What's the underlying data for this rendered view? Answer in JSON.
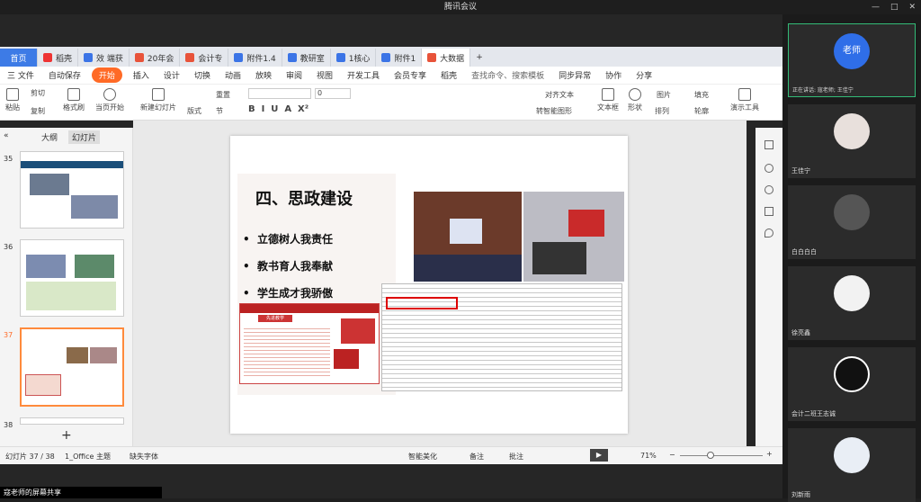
{
  "title": "腾讯会议",
  "tabs": [
    {
      "label": "首页"
    },
    {
      "label": "稻壳"
    },
    {
      "label": "效 端获"
    },
    {
      "label": "20年会"
    },
    {
      "label": "会计专"
    },
    {
      "label": "附件1.4"
    },
    {
      "label": "教研室"
    },
    {
      "label": "1核心"
    },
    {
      "label": "附件1"
    },
    {
      "label": "大数据"
    }
  ],
  "menus": [
    "三 文件",
    "自动保存",
    "开始",
    "插入",
    "设计",
    "切换",
    "动画",
    "放映",
    "审阅",
    "视图",
    "开发工具",
    "会员专享",
    "稻壳",
    "查找命令、搜索模板",
    "同步异常",
    "协作",
    "分享"
  ],
  "ribbon": {
    "paste": "粘贴",
    "cut": "剪切",
    "copy": "复制",
    "format": "格式刷",
    "play": "当页开始",
    "newslide": "新建幻灯片",
    "layout": "版式",
    "section": "节",
    "reset": "重置",
    "textbox": "文本框",
    "shape": "形状",
    "arrange": "排列",
    "picture": "图片",
    "fill": "填充",
    "outline": "轮廓",
    "presenter": "演示工具",
    "align": "对齐文本",
    "smartart": "转智能图形",
    "fontsize": "0"
  },
  "leftpane": {
    "tab1": "大纲",
    "tab2": "幻灯片",
    "collapse": "«",
    "nums": [
      "35",
      "36",
      "37",
      "38"
    ],
    "add": "+"
  },
  "slide": {
    "heading": "四、思政建设",
    "bullets": [
      "立德树人我责任",
      "教书育人我奉献",
      "学生成才我骄傲"
    ],
    "banner": "先进教学"
  },
  "statusbar": {
    "pages": "幻灯片 37 / 38",
    "theme": "1_Office 主题",
    "font": "缺失字体",
    "beautify": "智能美化",
    "notes": "备注",
    "comment": "批注",
    "zoom": "71%",
    "minus": "−",
    "plus": "+"
  },
  "share": "寇老师的屏幕共享",
  "speaking": "正在讲话: 寇老师; 王佳宁",
  "participants": [
    {
      "name": "老师",
      "label": "老师"
    },
    {
      "name": "王佳宁"
    },
    {
      "name": "白白白白"
    },
    {
      "name": "徐亮鑫"
    },
    {
      "name": "会计二班王志诚"
    },
    {
      "name": "刘新雨"
    }
  ],
  "winctl": [
    "—",
    "□",
    "✕"
  ]
}
